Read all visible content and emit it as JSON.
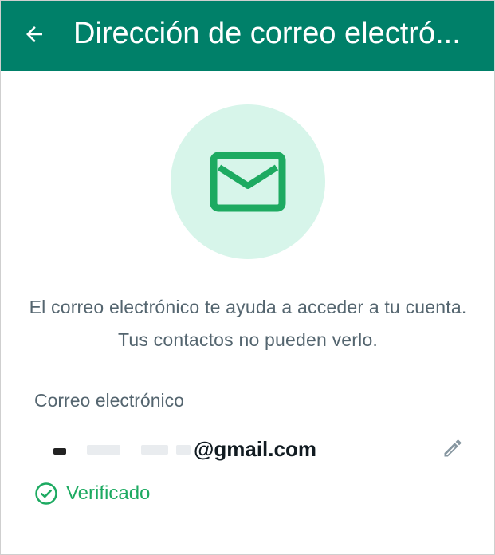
{
  "colors": {
    "appbar": "#008069",
    "accent": "#1DAA61",
    "hero_circle": "#D7F5EA",
    "text_secondary": "#54656F",
    "text_primary": "#111B21"
  },
  "appbar": {
    "back_icon": "arrow-left-icon",
    "title": "Dirección de correo electró..."
  },
  "hero": {
    "icon": "mail-envelope-icon"
  },
  "description": "El correo electrónico te ayuda a acceder a tu cuenta. Tus contactos no pueden verlo.",
  "email_section": {
    "label": "Correo electrónico",
    "value_visible": "@gmail.com",
    "edit_icon": "pencil-edit-icon"
  },
  "status": {
    "icon": "check-circle-icon",
    "label": "Verificado"
  }
}
